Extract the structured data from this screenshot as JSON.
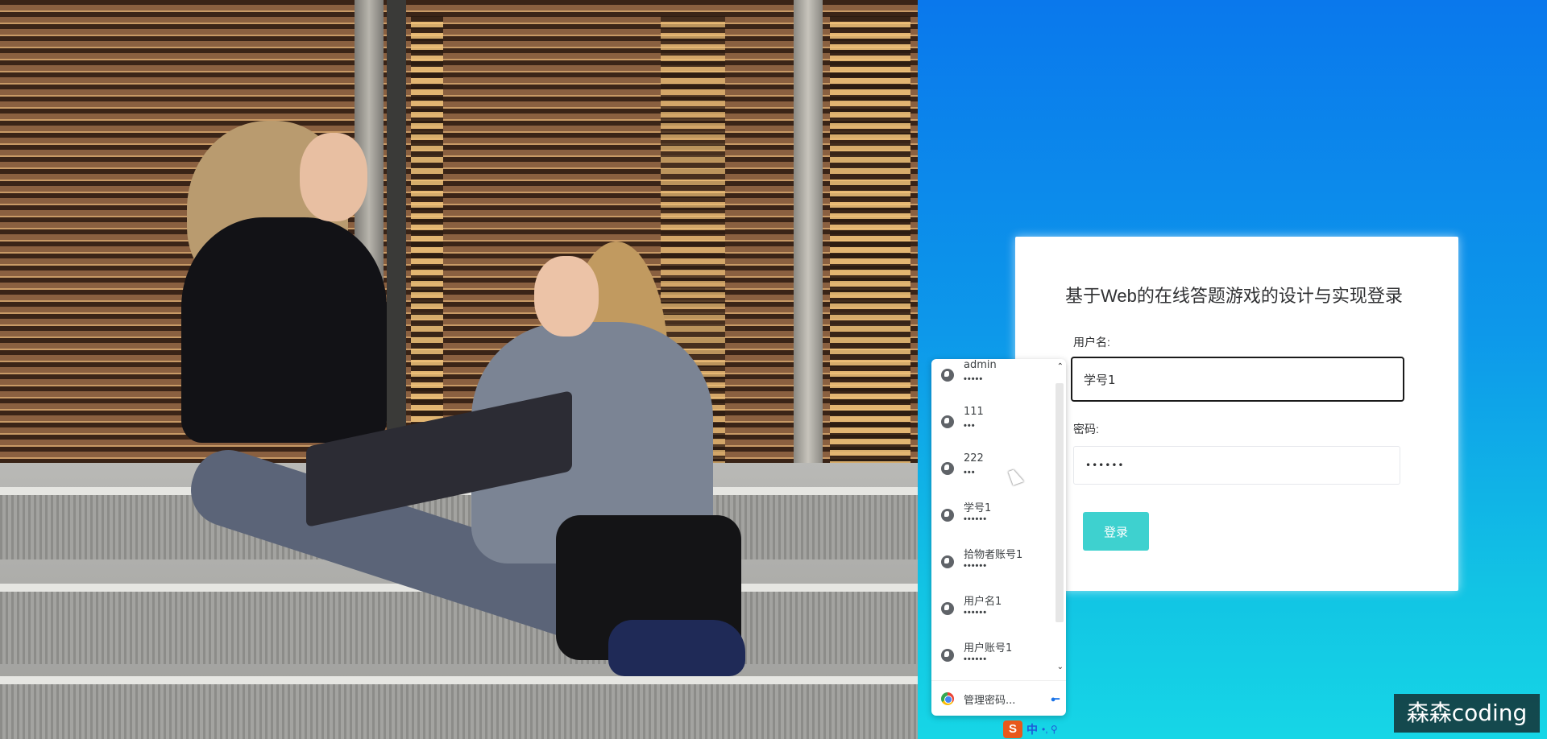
{
  "login": {
    "title": "基于Web的在线答题游戏的设计与实现登录",
    "username_label": "用户名:",
    "username_value": "学号1",
    "password_label": "密码:",
    "password_value": "••••••",
    "submit_label": "登录"
  },
  "autofill": {
    "items": [
      {
        "name": "admin",
        "password": "•••••"
      },
      {
        "name": "111",
        "password": "•••"
      },
      {
        "name": "222",
        "password": "•••"
      },
      {
        "name": "学号1",
        "password": "••••••"
      },
      {
        "name": "拾物者账号1",
        "password": "••••••"
      },
      {
        "name": "用户名1",
        "password": "••••••"
      },
      {
        "name": "用户账号1",
        "password": "••••••"
      }
    ],
    "manage_label": "管理密码...",
    "key_icon": "key-icon"
  },
  "ime": {
    "lang": "中",
    "symbols": "•, ⚲"
  },
  "watermark": "森森coding",
  "colors": {
    "button": "#3ed1cf",
    "bg_top": "#0a78ec",
    "bg_bottom": "#16d6e6"
  }
}
